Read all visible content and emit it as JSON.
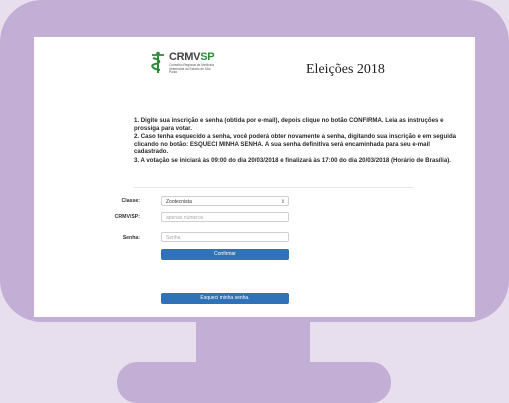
{
  "logo": {
    "brand_main": "CRMV",
    "brand_accent": "SP",
    "subtitle": "Conselho Regional de Medicina Veterinária do Estado de São Paulo"
  },
  "page": {
    "title": "Eleições 2018"
  },
  "instructions": [
    "1. Digite sua inscrição e senha (obtida por e-mail), depois clique no botão CONFIRMA. Leia as instruções e prossiga para votar.",
    "2. Caso tenha esquecido a senha, você poderá obter novamente a senha, digitando sua inscrição e em seguida clicando no botão: ESQUECI MINHA SENHA. A sua senha definitiva será encaminhada para seu e-mail cadastrado.",
    "3. A votação se iniciará às 09:00 do dia 20/03/2018 e finalizará às 17:00 do dia 20/03/2018 (Horário de Brasília)."
  ],
  "form": {
    "classe_label": "Classe:",
    "classe_value": "Zootecnista",
    "crmv_label": "CRMV/SP:",
    "crmv_placeholder": "apenas números",
    "senha_label": "Senha:",
    "senha_placeholder": "Senha",
    "confirm_label": "Confirmar",
    "forgot_label": "Esqueci minha senha."
  },
  "colors": {
    "frame": "#c3aed6",
    "button": "#2f72b7",
    "brand_green": "#2f8a3a"
  }
}
